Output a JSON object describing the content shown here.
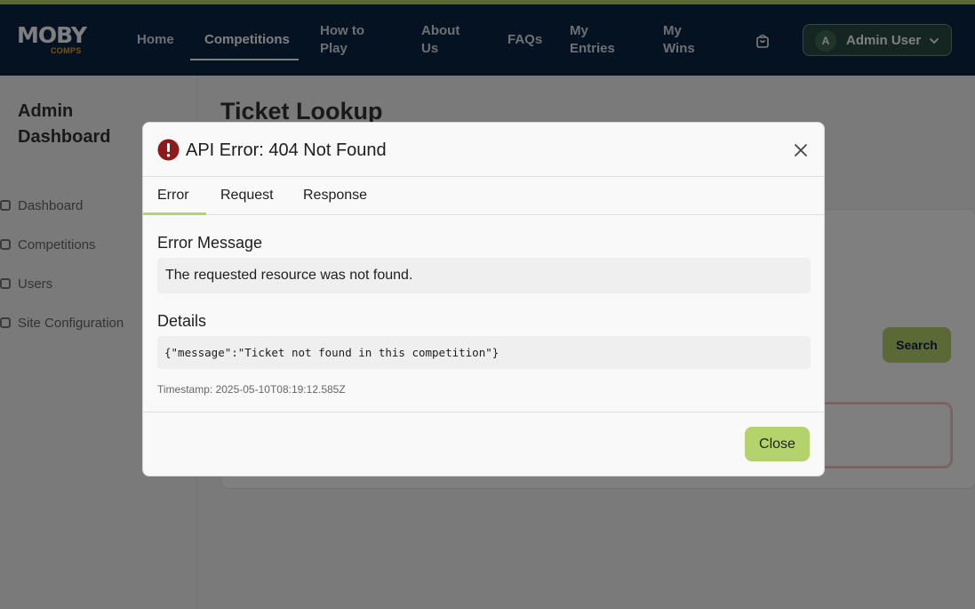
{
  "brand": {
    "logo_main": "MOBY",
    "logo_sub": "COMPS"
  },
  "nav": {
    "items": [
      {
        "label": "Home"
      },
      {
        "label": "Competitions"
      },
      {
        "label": "How to Play"
      },
      {
        "label": "About Us"
      },
      {
        "label": "FAQs"
      },
      {
        "label": "My Entries"
      },
      {
        "label": "My Wins"
      }
    ],
    "active": "Competitions",
    "cart_icon": "shopping-bag-icon",
    "user": {
      "initial": "A",
      "name": "Admin User",
      "menu_icon": "chevron-down-icon"
    }
  },
  "sidebar": {
    "title": "Admin Dashboard",
    "items": [
      {
        "label": "Dashboard"
      },
      {
        "label": "Competitions"
      },
      {
        "label": "Users"
      },
      {
        "label": "Site Configuration"
      }
    ]
  },
  "main": {
    "title": "Ticket Lookup",
    "search_label": "Search"
  },
  "modal": {
    "title": "API Error: 404 Not Found",
    "icon": "error-circle-icon",
    "tabs": [
      {
        "label": "Error"
      },
      {
        "label": "Request"
      },
      {
        "label": "Response"
      }
    ],
    "active_tab": "Error",
    "error_message_label": "Error Message",
    "error_message": "The requested resource was not found.",
    "details_label": "Details",
    "details": "{\"message\":\"Ticket not found in this competition\"}",
    "timestamp": "Timestamp: 2025-05-10T08:19:12.585Z",
    "close_label": "Close"
  },
  "colors": {
    "accent": "#b5d36d",
    "navbar": "#0b2545",
    "error": "#8b1a1a",
    "logo_orange": "#f3a81b"
  }
}
